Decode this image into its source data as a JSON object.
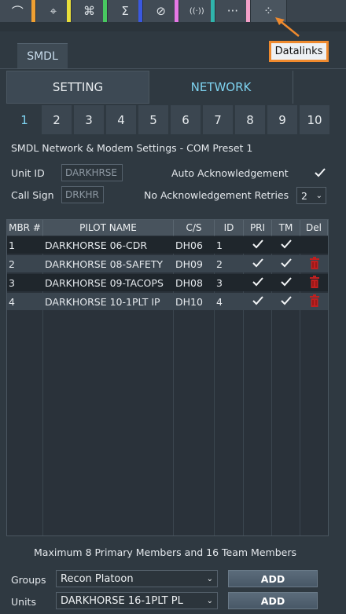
{
  "toolbar": {
    "buttons": [
      {
        "icon": "route-icon",
        "glyph": "⌒",
        "stripe": "#f0a032"
      },
      {
        "icon": "target-icon",
        "glyph": "⌖",
        "stripe": "#e8de3a"
      },
      {
        "icon": "command-icon",
        "glyph": "⌘",
        "stripe": "#48c860"
      },
      {
        "icon": "sigma-icon",
        "glyph": "Σ",
        "stripe": "#3a58e0"
      },
      {
        "icon": "cancel-icon",
        "glyph": "⊘",
        "stripe": "#e678e6"
      },
      {
        "icon": "radio-icon",
        "glyph": "((·))",
        "stripe": "#30b4ac"
      },
      {
        "icon": "more-icon",
        "glyph": "···",
        "stripe": "#f4a0c8"
      },
      {
        "icon": "datalinks-icon",
        "glyph": "⁘",
        "stripe": ""
      }
    ]
  },
  "tooltip": {
    "text": "Datalinks"
  },
  "tabs": {
    "smdl": "SMDL"
  },
  "modes": {
    "setting": "SETTING",
    "network": "NETWORK"
  },
  "presets": [
    "1",
    "2",
    "3",
    "4",
    "5",
    "6",
    "7",
    "8",
    "9",
    "10"
  ],
  "selected_preset": "1",
  "section_title": "SMDL Network & Modem Settings - COM Preset  1",
  "unit_id": {
    "label": "Unit ID",
    "value": "DARKHRSE"
  },
  "call_sign": {
    "label": "Call Sign",
    "value": "DRKHR"
  },
  "auto_ack": {
    "label": "Auto Acknowledgement",
    "checked": true
  },
  "retries": {
    "label": "No Acknowledgement Retries",
    "value": "2"
  },
  "table": {
    "headers": [
      "MBR #",
      "PILOT NAME",
      "C/S",
      "ID",
      "PRI",
      "TM",
      "Del"
    ],
    "rows": [
      {
        "mbr": "1",
        "pilot": "DARKHORSE 06-CDR",
        "cs": "DH06",
        "id": "1",
        "pri": true,
        "tm": true,
        "del": false
      },
      {
        "mbr": "2",
        "pilot": "DARKHORSE 08-SAFETY",
        "cs": "DH09",
        "id": "2",
        "pri": true,
        "tm": true,
        "del": true
      },
      {
        "mbr": "3",
        "pilot": "DARKHORSE 09-TACOPS",
        "cs": "DH08",
        "id": "3",
        "pri": true,
        "tm": true,
        "del": true
      },
      {
        "mbr": "4",
        "pilot": "DARKHORSE 10-1PLT IP",
        "cs": "DH10",
        "id": "4",
        "pri": true,
        "tm": true,
        "del": true
      }
    ]
  },
  "note": "Maximum 8 Primary Members and 16 Team Members",
  "groups": {
    "label": "Groups",
    "value": "Recon Platoon",
    "add": "ADD"
  },
  "units": {
    "label": "Units",
    "value": "DARKHORSE 16-1PLT PL",
    "add": "ADD"
  },
  "colors": {
    "accent": "#7ed3f0",
    "highlight": "#ef8a2e",
    "delete": "#c02020"
  }
}
